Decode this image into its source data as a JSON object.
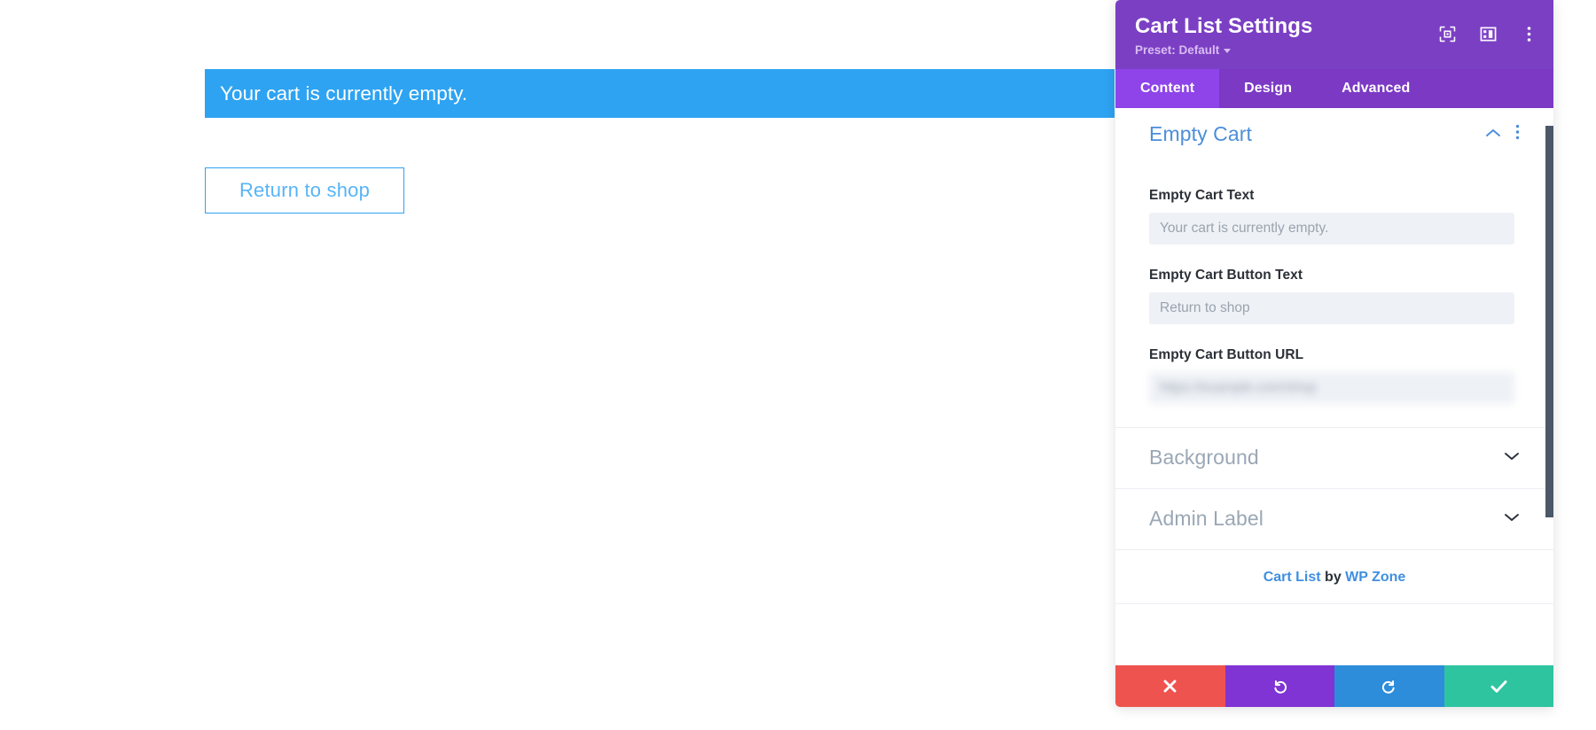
{
  "page": {
    "notice_text": "Your cart is currently empty.",
    "return_button_label": "Return to shop",
    "notice_bg_color": "#2ea3f2",
    "button_border_color": "#2ea3f2"
  },
  "panel": {
    "title": "Cart List Settings",
    "preset_label": "Preset: Default",
    "header_bg_color": "#7b3fc4",
    "active_tab_color": "#8e44e8",
    "header_icons": [
      {
        "name": "focus-icon"
      },
      {
        "name": "layout-panel-icon"
      },
      {
        "name": "more-vertical-icon"
      }
    ],
    "tabs": [
      {
        "label": "Content",
        "active": true
      },
      {
        "label": "Design",
        "active": false
      },
      {
        "label": "Advanced",
        "active": false
      }
    ],
    "sections": [
      {
        "title": "Empty Cart",
        "state": "expanded",
        "title_color": "#4c8ed9",
        "fields": [
          {
            "label": "Empty Cart Text",
            "value": "",
            "placeholder": "Your cart is currently empty.",
            "redacted": false
          },
          {
            "label": "Empty Cart Button Text",
            "value": "",
            "placeholder": "Return to shop",
            "redacted": false
          },
          {
            "label": "Empty Cart Button URL",
            "value": "",
            "placeholder": "https://example.com/shop",
            "redacted": true
          }
        ]
      },
      {
        "title": "Background",
        "state": "collapsed",
        "title_color": "#9aa7b5"
      },
      {
        "title": "Admin Label",
        "state": "collapsed",
        "title_color": "#9aa7b5"
      }
    ],
    "credit": {
      "module_name": "Cart List",
      "by": " by ",
      "author": "WP Zone"
    },
    "footer_buttons": [
      {
        "name": "discard-button",
        "glyph": "✖",
        "color": "#ef5350"
      },
      {
        "name": "undo-button",
        "glyph": "↺",
        "color": "#8034d4"
      },
      {
        "name": "redo-button",
        "glyph": "↻",
        "color": "#2d8ddb"
      },
      {
        "name": "save-button",
        "glyph": "✔",
        "color": "#2ec4a0"
      }
    ]
  }
}
